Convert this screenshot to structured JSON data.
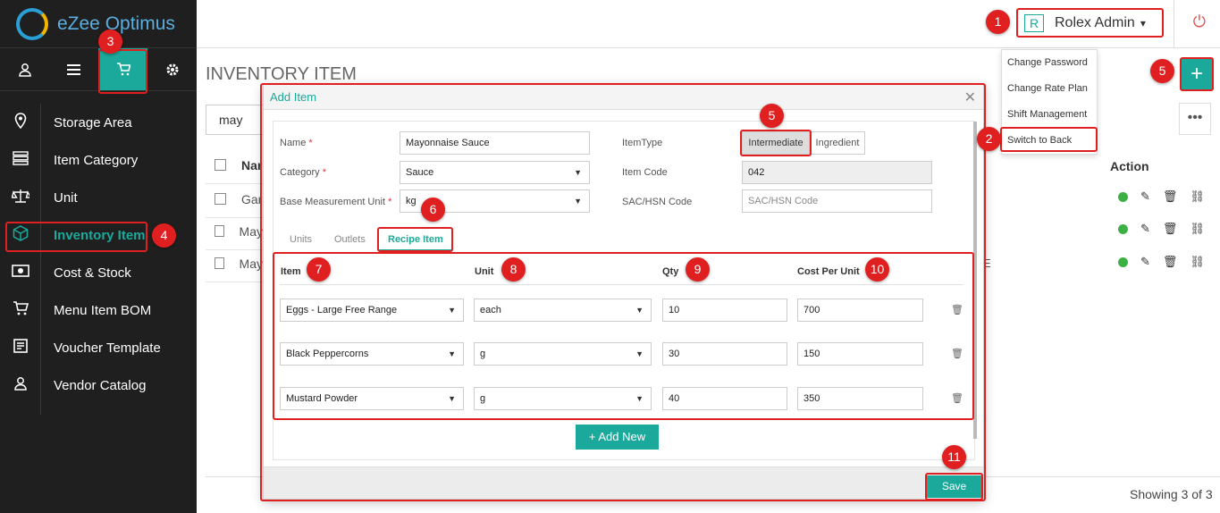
{
  "app": {
    "logo_text": "eZee Optimus"
  },
  "topbar": {
    "user_initial": "R",
    "user_name": "Rolex Admin",
    "caret": "▾",
    "power_icon": "⏻"
  },
  "user_menu": [
    "Change Password",
    "Change Rate Plan",
    "Shift Management",
    "Switch to Back"
  ],
  "sidebar": {
    "top_icons": [
      "user-icon",
      "list-icon",
      "cart-icon",
      "gear-icon"
    ],
    "items": [
      {
        "label": "Storage Area",
        "icon": "location-pin-icon"
      },
      {
        "label": "Item Category",
        "icon": "category-list-icon"
      },
      {
        "label": "Unit",
        "icon": "scale-icon"
      },
      {
        "label": "Inventory Item",
        "icon": "box-icon",
        "active": true
      },
      {
        "label": "Cost & Stock",
        "icon": "money-icon"
      },
      {
        "label": "Menu Item BOM",
        "icon": "cart-icon"
      },
      {
        "label": "Voucher Template",
        "icon": "voucher-icon"
      },
      {
        "label": "Vendor Catalog",
        "icon": "vendor-icon"
      }
    ]
  },
  "page": {
    "title": "INVENTORY ITEM",
    "search_value": "may",
    "header_col": "Nar",
    "rows": [
      "Gar",
      "May",
      "May"
    ],
    "action_header": "Action",
    "row_trailing": "E",
    "showing": "Showing 3 of 3",
    "add_symbol": "+",
    "more_symbol": "•••"
  },
  "modal": {
    "title": "Add Item",
    "close_symbol": "✕",
    "name_label": "Name",
    "name_value": "Mayonnaise Sauce",
    "category_label": "Category",
    "category_value": "Sauce",
    "bmu_label": "Base Measurement Unit",
    "bmu_value": "kg",
    "item_type_label": "ItemType",
    "item_type_options": [
      "Intermediate",
      "Ingredient"
    ],
    "item_code_label": "Item Code",
    "item_code_value": "042",
    "sac_label": "SAC/HSN Code",
    "sac_placeholder": "SAC/HSN Code",
    "tabs": [
      "Units",
      "Outlets",
      "Recipe Item"
    ],
    "recipe_headers": [
      "Item",
      "Unit",
      "Qty",
      "Cost Per Unit"
    ],
    "recipe_rows": [
      {
        "item": "Eggs - Large Free Range",
        "unit": "each",
        "qty": "10",
        "cost": "700"
      },
      {
        "item": "Black Peppercorns",
        "unit": "g",
        "qty": "30",
        "cost": "150"
      },
      {
        "item": "Mustard Powder",
        "unit": "g",
        "qty": "40",
        "cost": "350"
      }
    ],
    "add_new_label": "+ Add New",
    "save_label": "Save"
  },
  "annotations": [
    "1",
    "2",
    "3",
    "4",
    "5",
    "5",
    "6",
    "7",
    "8",
    "9",
    "10",
    "11"
  ],
  "colors": {
    "accent": "#1aa99a",
    "annotation": "#e02020",
    "sidebar_bg": "#1f1f1f",
    "status_green": "#3cb043"
  }
}
